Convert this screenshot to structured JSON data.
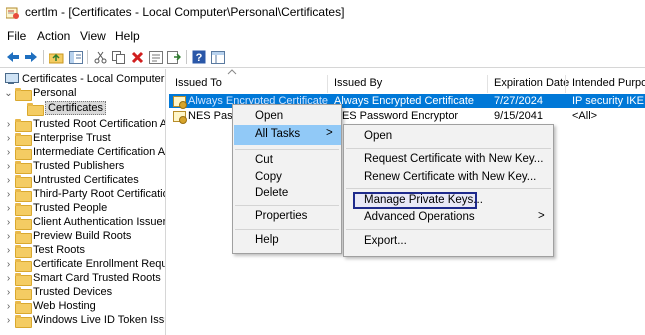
{
  "window": {
    "title": "certlm - [Certificates - Local Computer\\Personal\\Certificates]"
  },
  "menubar": {
    "items": [
      "File",
      "Action",
      "View",
      "Help"
    ]
  },
  "toolbar": {
    "icons": [
      "back-arrow-icon",
      "forward-arrow-icon",
      "up-folder-icon",
      "show-hide-tree-icon",
      "cut-icon",
      "copy-icon",
      "delete-icon",
      "properties-icon",
      "export-list-icon",
      "help-icon",
      "console-view-icon"
    ]
  },
  "tree": {
    "root": "Certificates - Local Computer",
    "personal": "Personal",
    "certificates": "Certificates",
    "stores": [
      "Trusted Root Certification Au",
      "Enterprise Trust",
      "Intermediate Certification Au",
      "Trusted Publishers",
      "Untrusted Certificates",
      "Third-Party Root Certification",
      "Trusted People",
      "Client Authentication Issuers",
      "Preview Build Roots",
      "Test Roots",
      "Certificate Enrollment Reques",
      "Smart Card Trusted Roots",
      "Trusted Devices",
      "Web Hosting",
      "Windows Live ID Token Issuer"
    ]
  },
  "list": {
    "columns": [
      "Issued To",
      "Issued By",
      "Expiration Date",
      "Intended Purpos"
    ],
    "rows": [
      {
        "issued_to": "Always Encrypted Certificate",
        "issued_by": "Always Encrypted Certificate",
        "expiration": "7/27/2024",
        "purpose": "IP security IKE int"
      },
      {
        "issued_to": "NES Pass",
        "issued_by": "NES Password Encryptor",
        "expiration": "9/15/2041",
        "purpose": "<All>"
      }
    ]
  },
  "context_menu": {
    "items": [
      "Open",
      "All Tasks",
      "Cut",
      "Copy",
      "Delete",
      "Properties",
      "Help"
    ],
    "submenu_arrow": ">"
  },
  "submenu": {
    "items": [
      "Open",
      "Request Certificate with New Key...",
      "Renew Certificate with New Key...",
      "Manage Private Keys...",
      "Advanced Operations",
      "Export..."
    ],
    "submenu_arrow": ">"
  },
  "colors": {
    "selection": "#0078d7",
    "menu_highlight": "#91c9f7",
    "focus_box": "#1e2a8c"
  }
}
